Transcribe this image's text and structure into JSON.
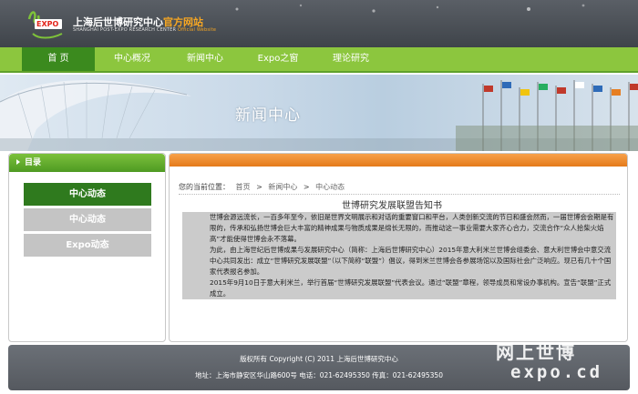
{
  "header": {
    "logo_text": "EXPO",
    "site_name_cn": "上海后世博研究中心",
    "site_name_suffix": "官方网站",
    "site_name_en": "SHANGHAI POST-EXPO RESEARCH CENTER",
    "site_name_en_suffix": "Official Website"
  },
  "nav": {
    "items": [
      {
        "label": "首 页",
        "active": true
      },
      {
        "label": "中心概况",
        "active": false
      },
      {
        "label": "新闻中心",
        "active": false
      },
      {
        "label": "Expo之窗",
        "active": false
      },
      {
        "label": "理论研究",
        "active": false
      }
    ]
  },
  "banner": {
    "title": "新闻中心"
  },
  "sidebar": {
    "heading": "目录",
    "items": [
      {
        "label": "中心动态",
        "active": true
      },
      {
        "label": "中心动态",
        "active": false
      },
      {
        "label": "Expo动态",
        "active": false
      }
    ]
  },
  "breadcrumb": {
    "prefix": "您的当前位置：",
    "items": [
      "首页",
      "新闻中心",
      "中心动态"
    ],
    "separator": ">"
  },
  "article": {
    "title": "世博研究发展联盟告知书",
    "paragraphs": [
      "世博会源远流长，一百多年至今，依旧是世界文明展示和对话的重要窗口和平台，人类创新交流的节日和盛会然而，一届世博会会期是有限的，传承和弘扬世博会巨大丰富的精神成果与物质成果是绵长无限的，而推动这一事业需要大家齐心合力，交流合作“众人拾柴火焰高”才能使得世博会永不落幕。",
      "为此，由上海世纪后世博成果与发展研究中心（简称：上海后世博研究中心）2015年意大利米兰世博会组委会、意大利世博会中意交流中心共同发出：成立“世博研究发展联盟”（以下简称“联盟”）倡议，得到米兰世博会各参展场馆以及国际社会广泛响应。现已有几十个国家代表报名参加。",
      "2015年9月10日于意大利米兰，举行首届“世博研究发展联盟”代表会议。通过“联盟”章程，领导成员和常设办事机构。宣告“联盟”正式成立。"
    ]
  },
  "footer": {
    "copyright": "版权所有 Copyright (C) 2011 上海后世博研究中心",
    "address": "地址：上海市静安区华山路600号 电话：021-62495350 传真：021-62495350"
  },
  "watermark": {
    "line1": "网上世博",
    "line2": "expo.cd"
  },
  "colors": {
    "nav_green": "#8cc63e",
    "nav_active": "#3b8a1e",
    "accent_orange": "#e47a1a",
    "header_gray": "#4a4f55"
  }
}
